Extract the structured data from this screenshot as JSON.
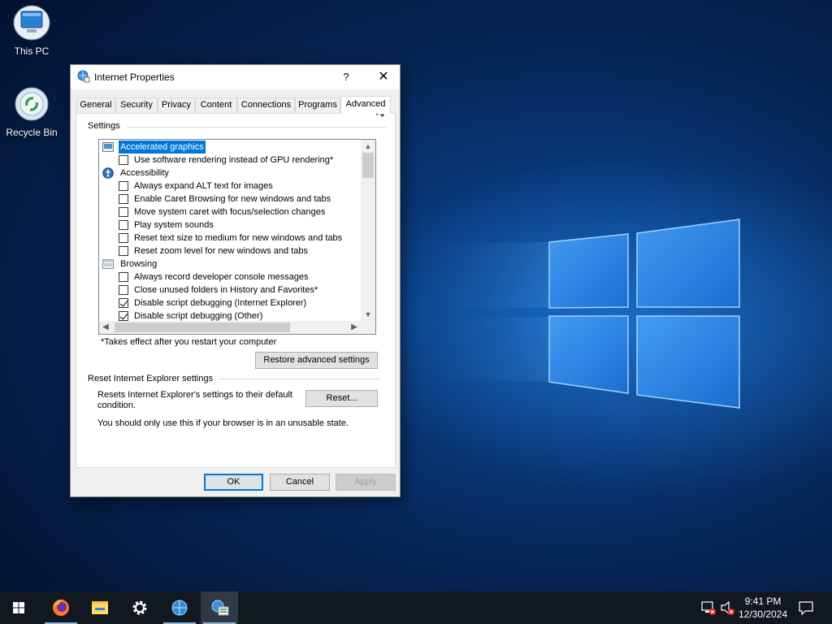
{
  "desktop": {
    "icons": [
      {
        "label": "This PC"
      },
      {
        "label": "Recycle Bin"
      }
    ]
  },
  "dialog": {
    "title": "Internet Properties",
    "help_glyph": "?",
    "close_glyph": "✕",
    "tabs": [
      {
        "label": "General"
      },
      {
        "label": "Security"
      },
      {
        "label": "Privacy"
      },
      {
        "label": "Content"
      },
      {
        "label": "Connections"
      },
      {
        "label": "Programs"
      },
      {
        "label": "Advanced",
        "active": true
      }
    ],
    "settings_group": "Settings",
    "settings_items": [
      {
        "type": "category",
        "label": "Accelerated graphics",
        "selected": true,
        "icon": "graphics-icon"
      },
      {
        "type": "checkbox",
        "label": "Use software rendering instead of GPU rendering*",
        "checked": false
      },
      {
        "type": "category",
        "label": "Accessibility",
        "icon": "accessibility-icon"
      },
      {
        "type": "checkbox",
        "label": "Always expand ALT text for images",
        "checked": false
      },
      {
        "type": "checkbox",
        "label": "Enable Caret Browsing for new windows and tabs",
        "checked": false
      },
      {
        "type": "checkbox",
        "label": "Move system caret with focus/selection changes",
        "checked": false
      },
      {
        "type": "checkbox",
        "label": "Play system sounds",
        "checked": false
      },
      {
        "type": "checkbox",
        "label": "Reset text size to medium for new windows and tabs",
        "checked": false
      },
      {
        "type": "checkbox",
        "label": "Reset zoom level for new windows and tabs",
        "checked": false
      },
      {
        "type": "category",
        "label": "Browsing",
        "icon": "browsing-icon"
      },
      {
        "type": "checkbox",
        "label": "Always record developer console messages",
        "checked": false
      },
      {
        "type": "checkbox",
        "label": "Close unused folders in History and Favorites*",
        "checked": false
      },
      {
        "type": "checkbox",
        "label": "Disable script debugging (Internet Explorer)",
        "checked": true
      },
      {
        "type": "checkbox",
        "label": "Disable script debugging (Other)",
        "checked": true
      }
    ],
    "restart_note": "*Takes effect after you restart your computer",
    "restore_button": "Restore advanced settings",
    "reset_group": "Reset Internet Explorer settings",
    "reset_description": "Resets Internet Explorer's settings to their default condition.",
    "reset_button": "Reset...",
    "reset_warning": "You should only use this if your browser is in an unusable state.",
    "ok_button": "OK",
    "cancel_button": "Cancel",
    "apply_button": "Apply"
  },
  "taskbar": {
    "items": [
      {
        "icon": "start-icon"
      },
      {
        "icon": "firefox-icon"
      },
      {
        "icon": "file-explorer-icon"
      },
      {
        "icon": "settings-gear-icon"
      },
      {
        "icon": "internet-explorer-icon"
      },
      {
        "icon": "internet-options-icon"
      }
    ],
    "time": "9:41 PM",
    "date": "12/30/2024"
  },
  "colors": {
    "selection": "#0078d7",
    "taskbar": "#111820",
    "dialog_bg": "#f0f0f0"
  }
}
